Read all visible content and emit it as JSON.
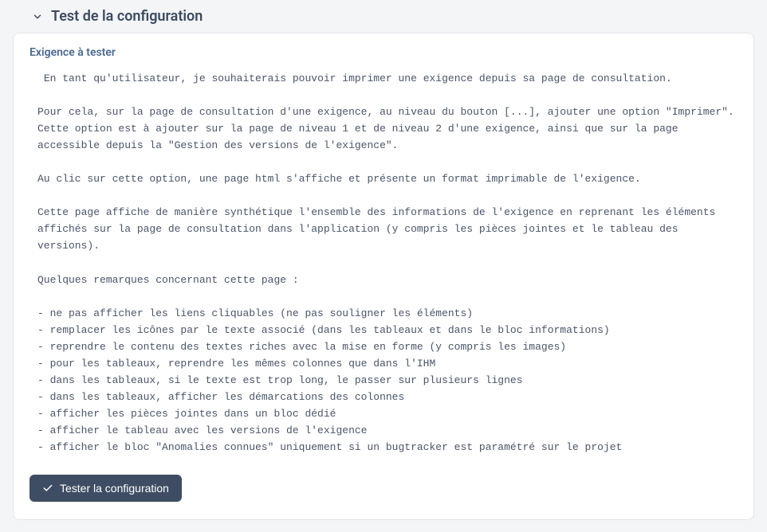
{
  "section": {
    "title": "Test de la configuration"
  },
  "panel": {
    "subtitle": "Exigence à tester",
    "requirement_text": " En tant qu'utilisateur, je souhaiterais pouvoir imprimer une exigence depuis sa page de consultation.\n\nPour cela, sur la page de consultation d'une exigence, au niveau du bouton [...], ajouter une option \"Imprimer\".\nCette option est à ajouter sur la page de niveau 1 et de niveau 2 d'une exigence, ainsi que sur la page accessible depuis la \"Gestion des versions de l'exigence\".\n\nAu clic sur cette option, une page html s'affiche et présente un format imprimable de l'exigence.\n\nCette page affiche de manière synthétique l'ensemble des informations de l'exigence en reprenant les éléments affichés sur la page de consultation dans l'application (y compris les pièces jointes et le tableau des versions).\n\nQuelques remarques concernant cette page :\n\n- ne pas afficher les liens cliquables (ne pas souligner les éléments)\n- remplacer les icônes par le texte associé (dans les tableaux et dans le bloc informations)\n- reprendre le contenu des textes riches avec la mise en forme (y compris les images)\n- pour les tableaux, reprendre les mêmes colonnes que dans l'IHM\n- dans les tableaux, si le texte est trop long, le passer sur plusieurs lignes\n- dans les tableaux, afficher les démarcations des colonnes\n- afficher les pièces jointes dans un bloc dédié\n- afficher le tableau avec les versions de l'exigence\n- afficher le bloc \"Anomalies connues\" uniquement si un bugtracker est paramétré sur le projet"
  },
  "buttons": {
    "test_config_label": "Tester la configuration"
  }
}
